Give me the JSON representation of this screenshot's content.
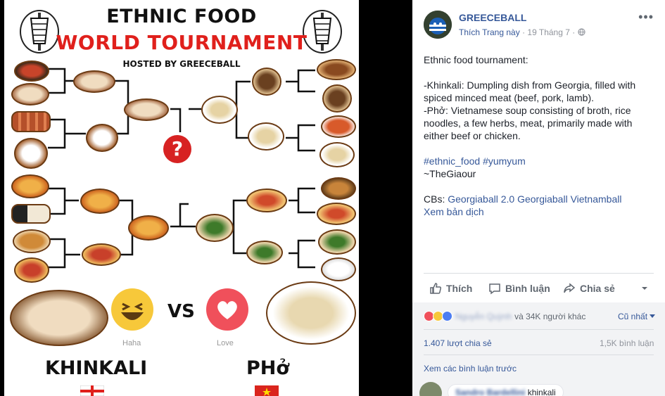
{
  "photo": {
    "title_line1": "ETHNIC FOOD",
    "title_line2": "WORLD TOURNAMENT",
    "title_line3": "HOSTED BY GREECEBALL",
    "question_mark": "?",
    "vs": "VS",
    "reaction_left": "Haha",
    "reaction_right": "Love",
    "finalist_left": "KHINKALI",
    "finalist_right": "PHở"
  },
  "post": {
    "page_name": "GREECEBALL",
    "like_page": "Thích Trang này",
    "separator": "·",
    "date": "19 Tháng 7",
    "more": "•••",
    "text_intro": "Ethnic food tournament:",
    "text_khinkali": "-Khinkali: Dumpling dish from Georgia, filled with spiced minced meat (beef, pork, lamb).",
    "text_pho": "-Phở: Vietnamese soup consisting of broth, rice noodles, a few herbs, meat, primarily made with either beef or chicken.",
    "hashtags": "#ethnic_food #yumyum",
    "signature": "~TheGiaour",
    "cbs_label": "CBs:",
    "cbs_links": "Georgiaball 2.0 Georgiaball Vietnamball",
    "translate": "Xem bản dịch"
  },
  "actions": {
    "like": "Thích",
    "comment": "Bình luận",
    "share": "Chia sẻ"
  },
  "engagement": {
    "reactor_name": "Nguyễn Quỳnh",
    "reactions_text": "và 34K người khác",
    "sort_label": "Cũ nhất",
    "shares": "1.407 lượt chia sẻ",
    "comments": "1,5K bình luận",
    "view_previous": "Xem các bình luận trước",
    "comment_author": "Sandro Bardellini",
    "comment_text": "khinkali"
  },
  "colors": {
    "brand_blue": "#365899",
    "title_red": "#e0201c",
    "love_red": "#f0505b",
    "haha_yellow": "#f7c83a"
  }
}
